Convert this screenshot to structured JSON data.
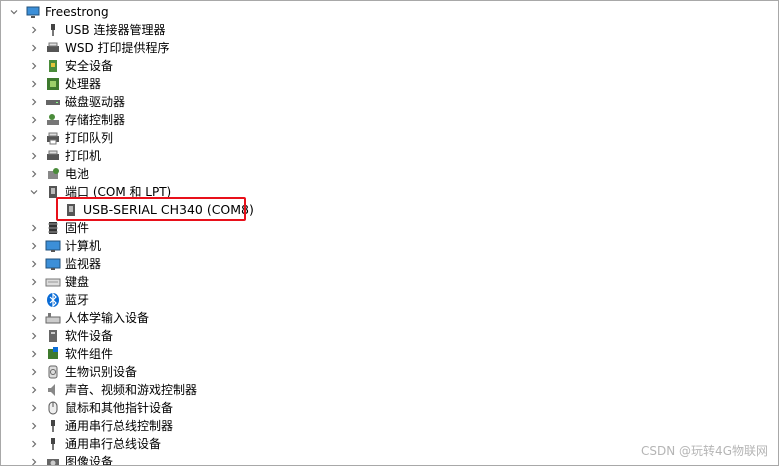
{
  "root": {
    "label": "Freestrong",
    "icon": "computer-icon"
  },
  "items": [
    {
      "label": "USB 连接器管理器",
      "icon": "usb-connector-icon"
    },
    {
      "label": "WSD 打印提供程序",
      "icon": "printer-icon"
    },
    {
      "label": "安全设备",
      "icon": "security-device-icon"
    },
    {
      "label": "处理器",
      "icon": "processor-icon"
    },
    {
      "label": "磁盘驱动器",
      "icon": "disk-drive-icon"
    },
    {
      "label": "存储控制器",
      "icon": "storage-controller-icon"
    },
    {
      "label": "打印队列",
      "icon": "print-queue-icon"
    },
    {
      "label": "打印机",
      "icon": "printer-icon"
    },
    {
      "label": "电池",
      "icon": "battery-icon"
    },
    {
      "label": "端口 (COM 和 LPT)",
      "icon": "port-icon"
    },
    {
      "label": "固件",
      "icon": "firmware-icon"
    },
    {
      "label": "计算机",
      "icon": "computer-monitor-icon"
    },
    {
      "label": "监视器",
      "icon": "monitor-icon"
    },
    {
      "label": "键盘",
      "icon": "keyboard-icon"
    },
    {
      "label": "蓝牙",
      "icon": "bluetooth-icon"
    },
    {
      "label": "人体学输入设备",
      "icon": "hid-icon"
    },
    {
      "label": "软件设备",
      "icon": "software-device-icon"
    },
    {
      "label": "软件组件",
      "icon": "software-component-icon"
    },
    {
      "label": "生物识别设备",
      "icon": "biometric-icon"
    },
    {
      "label": "声音、视频和游戏控制器",
      "icon": "speaker-icon"
    },
    {
      "label": "鼠标和其他指针设备",
      "icon": "mouse-icon"
    },
    {
      "label": "通用串行总线控制器",
      "icon": "usb-icon"
    },
    {
      "label": "通用串行总线设备",
      "icon": "usb-icon"
    },
    {
      "label": "图像设备",
      "icon": "camera-icon"
    }
  ],
  "port_child": {
    "label": "USB-SERIAL CH340 (COM8)",
    "icon": "port-icon"
  },
  "watermark": "CSDN @玩转4G物联网",
  "colors": {
    "highlight": "#e8101a",
    "bluetooth": "#0a6cd6",
    "chevron": "#6a6a6a"
  }
}
